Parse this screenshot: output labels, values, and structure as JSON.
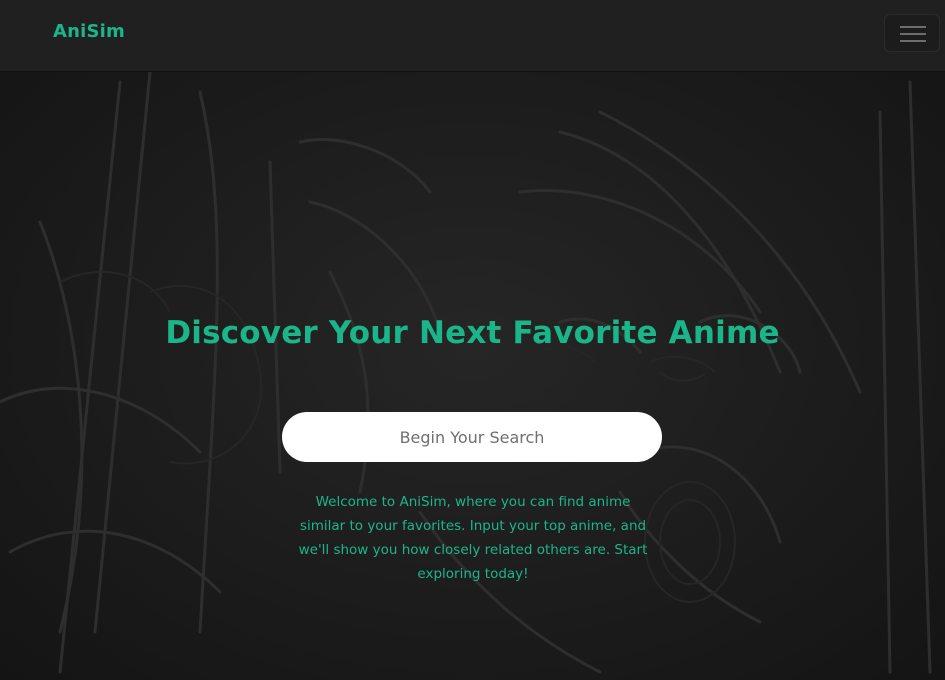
{
  "navbar": {
    "brand": "AniSim",
    "menu_icon": "hamburger-menu-icon"
  },
  "hero": {
    "background_art": "anime-line-art-background",
    "title": "Discover Your Next Favorite Anime",
    "search_button_label": "Begin Your Search",
    "description": "Welcome to AniSim, where you can find anime similar to your favorites. Input your top anime, and we'll show you how closely related others are. Start exploring today!"
  },
  "colors": {
    "accent": "#1bb58a",
    "navbar_bg": "#202020",
    "page_bg": "#1d1d1d",
    "button_bg": "#ffffff",
    "button_text": "#6f6f6f"
  }
}
